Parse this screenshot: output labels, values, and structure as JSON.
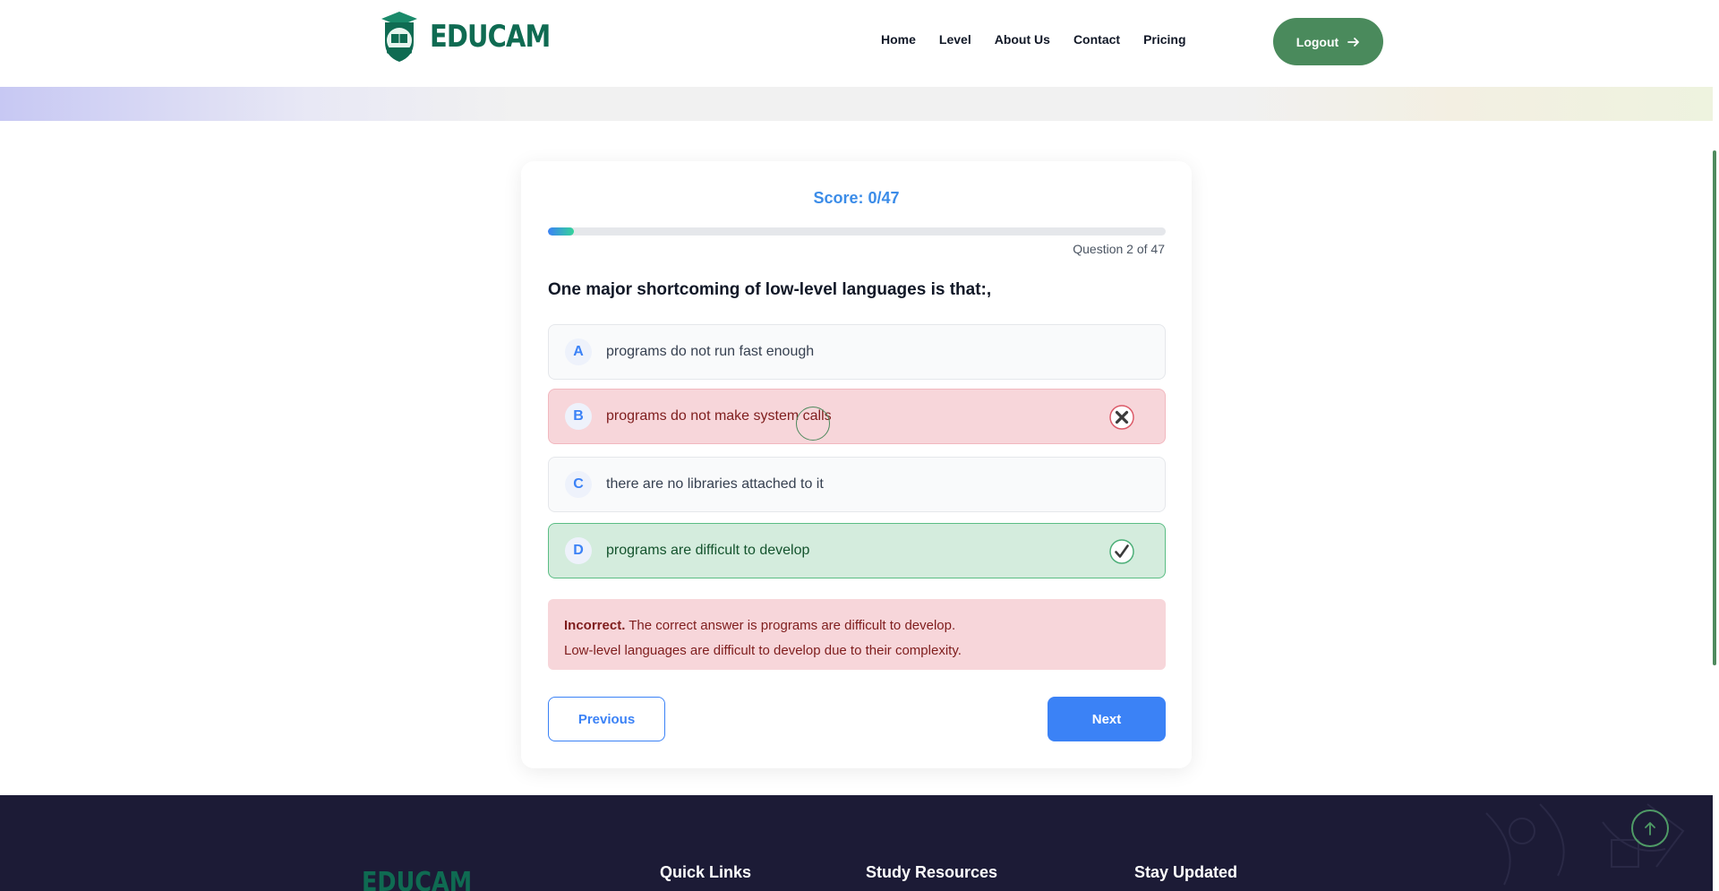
{
  "header": {
    "brand": "EDUCAM",
    "nav": [
      "Home",
      "Level",
      "About Us",
      "Contact",
      "Pricing"
    ],
    "logout_label": "Logout"
  },
  "quiz": {
    "score_label": "Score: 0/47",
    "progress_fraction": 0.0426,
    "question_count": "Question 2 of 47",
    "question": "One major shortcoming of low-level languages is that:,",
    "options": [
      {
        "letter": "A",
        "text": "programs do not run fast enough",
        "state": "neutral"
      },
      {
        "letter": "B",
        "text": "programs do not make system calls",
        "state": "wrong"
      },
      {
        "letter": "C",
        "text": "there are no libraries attached to it",
        "state": "neutral"
      },
      {
        "letter": "D",
        "text": "programs are difficult to develop",
        "state": "correct"
      }
    ],
    "feedback": {
      "label": "Incorrect.",
      "line1": "The correct answer is programs are difficult to develop.",
      "line2": "Low-level languages are difficult to develop due to their complexity."
    },
    "previous_label": "Previous",
    "next_label": "Next"
  },
  "footer": {
    "brand": "EDUCAM",
    "headings": [
      "Quick Links",
      "Study Resources",
      "Stay Updated"
    ]
  },
  "colors": {
    "accent_blue": "#3b82f6",
    "brand_green": "#0f6b52",
    "logout_green": "#4a8a5c",
    "wrong_bg": "#f7d6da",
    "correct_bg": "#d4ecdd",
    "footer_bg": "#1c1b36"
  },
  "icons": {
    "logout": "arrow-right-icon",
    "wrong": "x-circle-icon",
    "correct": "check-circle-icon",
    "back_to_top": "arrow-up-icon"
  }
}
